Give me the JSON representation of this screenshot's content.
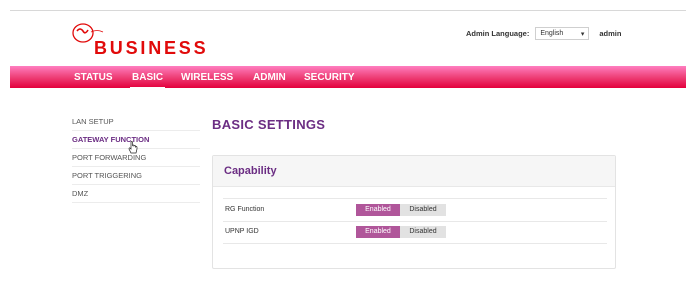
{
  "brand": {
    "name": "BUSINESS",
    "logo_text": "Virgin media"
  },
  "admin_bar": {
    "language_label": "Admin Language:",
    "language_value": "English",
    "user": "admin"
  },
  "nav": {
    "items": [
      {
        "label": "STATUS"
      },
      {
        "label": "BASIC"
      },
      {
        "label": "WIRELESS"
      },
      {
        "label": "ADMIN"
      },
      {
        "label": "SECURITY"
      }
    ],
    "active": "BASIC"
  },
  "sidebar": {
    "items": [
      {
        "label": "LAN SETUP"
      },
      {
        "label": "GATEWAY FUNCTION"
      },
      {
        "label": "PORT FORWARDING"
      },
      {
        "label": "PORT TRIGGERING"
      },
      {
        "label": "DMZ"
      }
    ],
    "active": "GATEWAY FUNCTION"
  },
  "main": {
    "title": "BASIC SETTINGS",
    "panel": {
      "title": "Capability",
      "rows": [
        {
          "label": "RG Function",
          "on_label": "Enabled",
          "off_label": "Disabled",
          "selected": "Enabled"
        },
        {
          "label": "UPNP IGD",
          "on_label": "Enabled",
          "off_label": "Disabled",
          "selected": "Enabled"
        }
      ]
    }
  },
  "colors": {
    "accent_purple": "#6b2d83",
    "brand_red": "#e10a0a",
    "nav_pink": "#f0477f",
    "toggle_on": "#b0569a"
  }
}
